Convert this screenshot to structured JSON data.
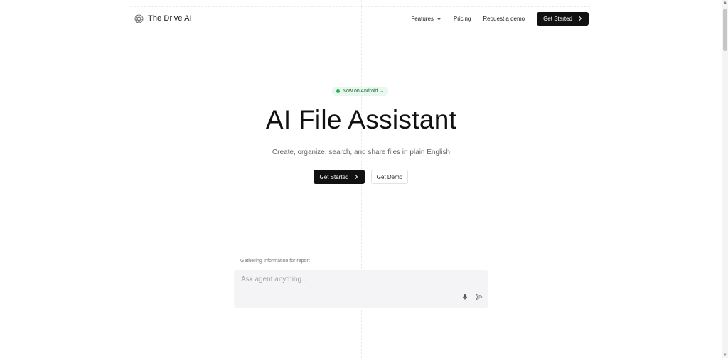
{
  "header": {
    "brand": "The Drive AI",
    "nav": {
      "features": "Features",
      "pricing": "Pricing",
      "request_demo": "Request a demo",
      "get_started": "Get Started"
    }
  },
  "hero": {
    "badge": "Now on Android →",
    "title": "AI File Assistant",
    "subtitle": "Create, organize, search, and share files in plain English",
    "primary_button": "Get Started",
    "secondary_button": "Get Demo"
  },
  "agent": {
    "status": "Gathering information for report",
    "placeholder": "Ask agent anything..."
  },
  "icons": {
    "brand": "flower-logo-icon",
    "features_chevron": "chevron-down-icon",
    "cta_chevron": "chevron-right-icon",
    "mic": "microphone-icon",
    "send": "send-icon"
  },
  "colors": {
    "primary": "#111111",
    "badge_bg": "#e9f7ee",
    "badge_dot": "#22b35b",
    "agent_bg": "#f4f3f6"
  }
}
